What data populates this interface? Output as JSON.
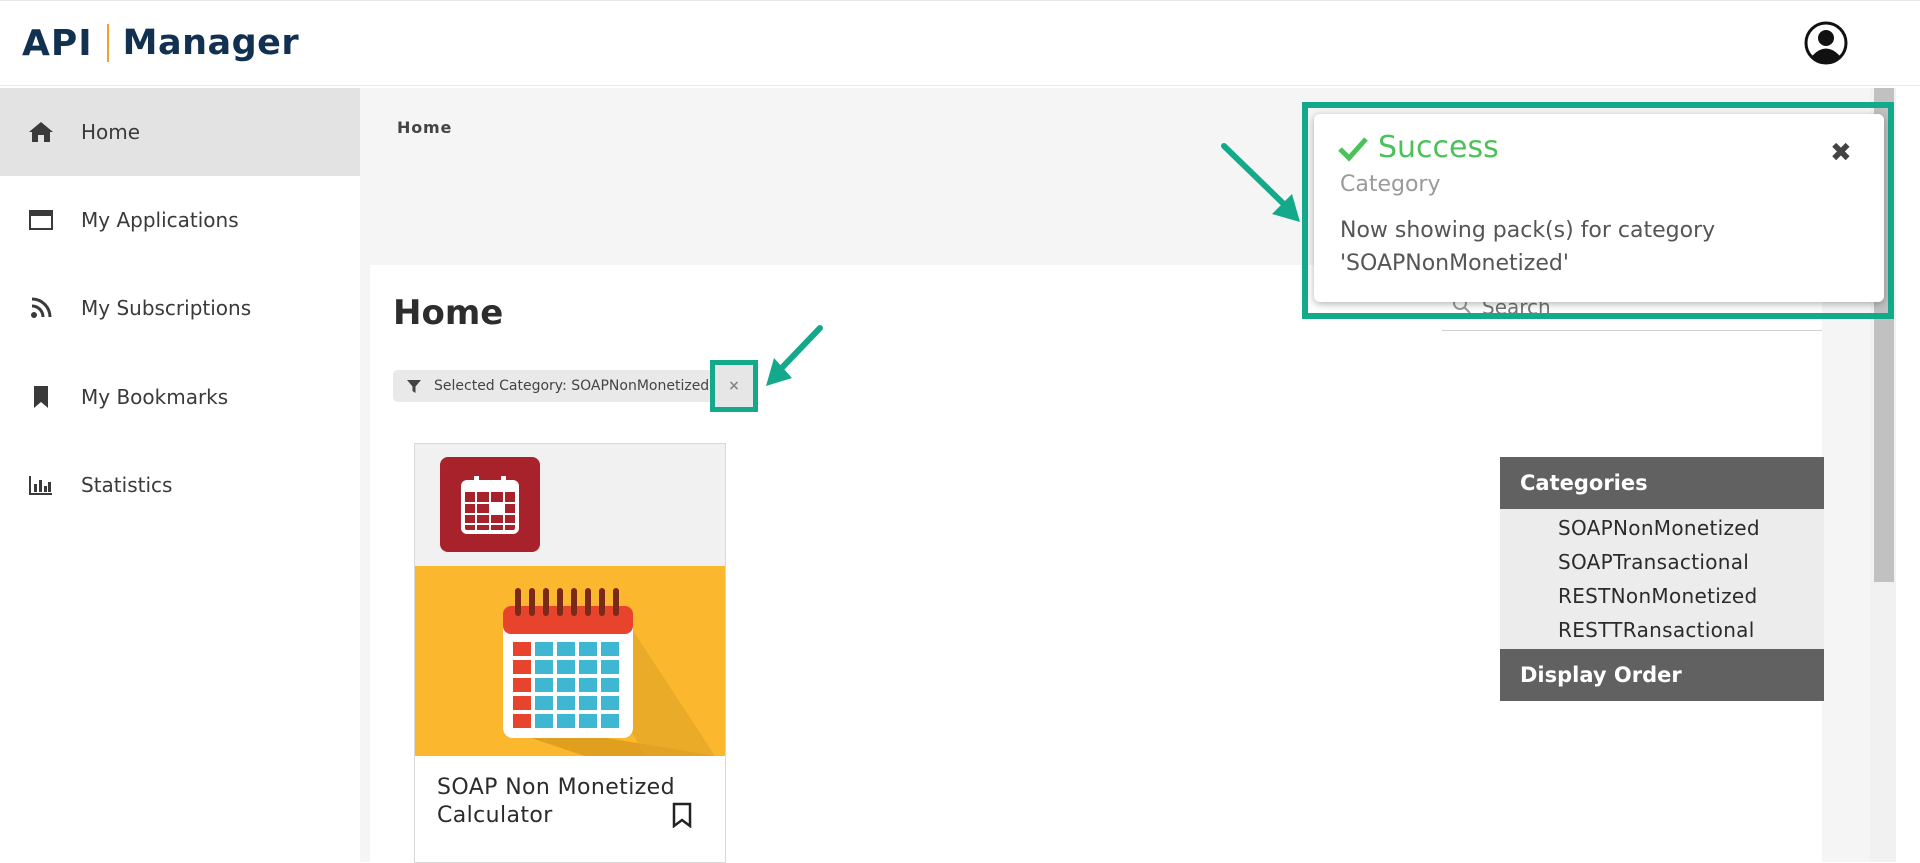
{
  "header": {
    "logo_api": "API",
    "logo_manager": "Manager",
    "user_icon": "user-circle-icon"
  },
  "sidebar": {
    "items": [
      {
        "label": "Home",
        "icon": "home-icon",
        "active": true
      },
      {
        "label": "My Applications",
        "icon": "window-icon",
        "active": false
      },
      {
        "label": "My Subscriptions",
        "icon": "rss-icon",
        "active": false
      },
      {
        "label": "My Bookmarks",
        "icon": "bookmark-icon",
        "active": false
      },
      {
        "label": "Statistics",
        "icon": "bar-chart-icon",
        "active": false
      }
    ]
  },
  "main": {
    "breadcrumb": "Home",
    "page_title": "Home",
    "search_placeholder": "Search",
    "filter_chip_label": "Selected Category: SOAPNonMonetized",
    "filter_chip_close": "×",
    "card": {
      "name": "SOAP Non Monetized Calculator"
    }
  },
  "categories": {
    "heading": "Categories",
    "items": [
      "SOAPNonMonetized",
      "SOAPTransactional",
      "RESTNonMonetized",
      "RESTTRansactional"
    ],
    "display_order_heading": "Display Order"
  },
  "toast": {
    "title": "Success",
    "subtitle": "Category",
    "message": "Now showing pack(s) for category 'SOAPNonMonetized'",
    "close": "✖"
  },
  "colors": {
    "brand_navy": "#12304f",
    "brand_orange": "#f0a12a",
    "highlight_teal": "#14a98a",
    "success_green": "#4cc15a",
    "panel_grey": "#616161"
  }
}
